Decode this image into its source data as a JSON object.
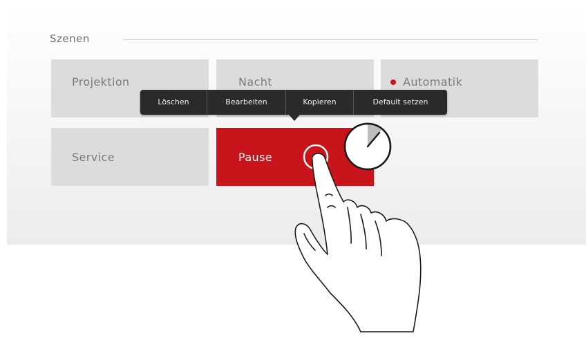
{
  "section": {
    "title": "Szenen"
  },
  "tiles": [
    {
      "label": "Projektion",
      "state": "default"
    },
    {
      "label": "Nacht",
      "state": "default"
    },
    {
      "label": "Automatik",
      "state": "default",
      "status_dot_color": "#c8141b"
    },
    {
      "label": "Service",
      "state": "default"
    },
    {
      "label": "Pause",
      "state": "active"
    }
  ],
  "context_menu": {
    "items": [
      "Löschen",
      "Bearbeiten",
      "Kopieren",
      "Default setzen"
    ]
  },
  "colors": {
    "accent": "#c8141b",
    "tile_background": "#dcdcdc",
    "menu_background": "#2a2a2a"
  },
  "gesture": {
    "type": "long-press",
    "icons": [
      "pointing-hand-icon",
      "timer-icon",
      "touch-point-icon"
    ]
  }
}
